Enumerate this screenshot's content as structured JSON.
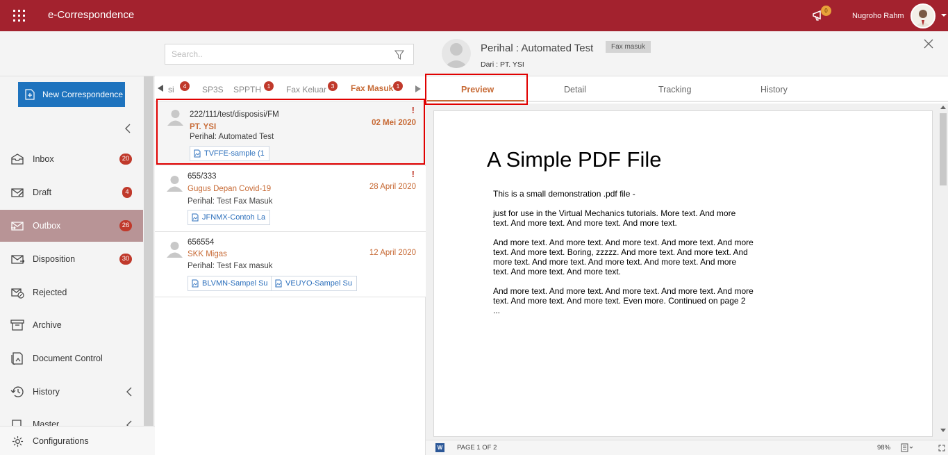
{
  "app": {
    "title": "e-Correspondence"
  },
  "header": {
    "user_name": "Nugroho Rahm",
    "notification_count": "0"
  },
  "sidebar": {
    "new_button_label": "New Correspondence",
    "items": [
      {
        "label": "Inbox",
        "badge": "20",
        "icon": "inbox-icon"
      },
      {
        "label": "Draft",
        "badge": "4",
        "icon": "draft-icon"
      },
      {
        "label": "Outbox",
        "badge": "26",
        "icon": "outbox-icon"
      },
      {
        "label": "Disposition",
        "badge": "30",
        "icon": "disposition-icon"
      },
      {
        "label": "Rejected",
        "badge": "",
        "icon": "rejected-icon"
      },
      {
        "label": "Archive",
        "badge": "",
        "icon": "archive-icon"
      },
      {
        "label": "Document Control",
        "badge": "",
        "icon": "document-control-icon"
      },
      {
        "label": "History",
        "badge": "",
        "icon": "history-icon"
      },
      {
        "label": "Master",
        "badge": "",
        "icon": "master-icon"
      }
    ],
    "config_label": "Configurations"
  },
  "list": {
    "search_placeholder": "Search..",
    "tabs": [
      {
        "label": "si",
        "badge": "4"
      },
      {
        "label": "SP3S",
        "badge": ""
      },
      {
        "label": "SPPTH",
        "badge": "1"
      },
      {
        "label": "Fax Keluar",
        "badge": "3"
      },
      {
        "label": "Fax Masuk",
        "badge": "1"
      }
    ],
    "messages": [
      {
        "ref": "222/111/test/disposisi/FM",
        "sender": "PT. YSI",
        "date": "02 Mei 2020",
        "subject": "Perihal: Automated Test",
        "priority": "!",
        "attachments": [
          "TVFFE-sample (1"
        ]
      },
      {
        "ref": "655/333",
        "sender": "Gugus Depan Covid-19",
        "date": "28 April 2020",
        "subject": "Perihal: Test Fax Masuk",
        "priority": "!",
        "attachments": [
          "JFNMX-Contoh La"
        ]
      },
      {
        "ref": "656554",
        "sender": "SKK Migas",
        "date": "12 April 2020",
        "subject": "Perihal: Test Fax masuk",
        "priority": "",
        "attachments": [
          "BLVMN-Sampel Su",
          "VEUYO-Sampel Su"
        ]
      }
    ]
  },
  "detail": {
    "title": "Perihal : Automated Test",
    "tag": "Fax masuk",
    "from": "Dari : PT. YSI",
    "tabs": [
      "Preview",
      "Detail",
      "Tracking",
      "History"
    ],
    "pdf": {
      "title": "A Simple PDF File",
      "paragraphs": [
        "This is a small demonstration .pdf file -",
        "just for use in the Virtual Mechanics tutorials. More text. And more text. And more text. And more text. And more text.",
        "And more text. And more text. And more text. And more text. And more text. And more text. Boring, zzzzz. And more text. And more text. And more text. And more text. And more text. And more text. And more text. And more text. And more text.",
        "And more text. And more text. And more text. And more text. And more text. And more text. And more text. Even more. Continued on page 2 ..."
      ]
    },
    "viewer": {
      "page_info": "PAGE 1 OF 2",
      "zoom": "98%",
      "file_icon_letter": "W"
    }
  }
}
